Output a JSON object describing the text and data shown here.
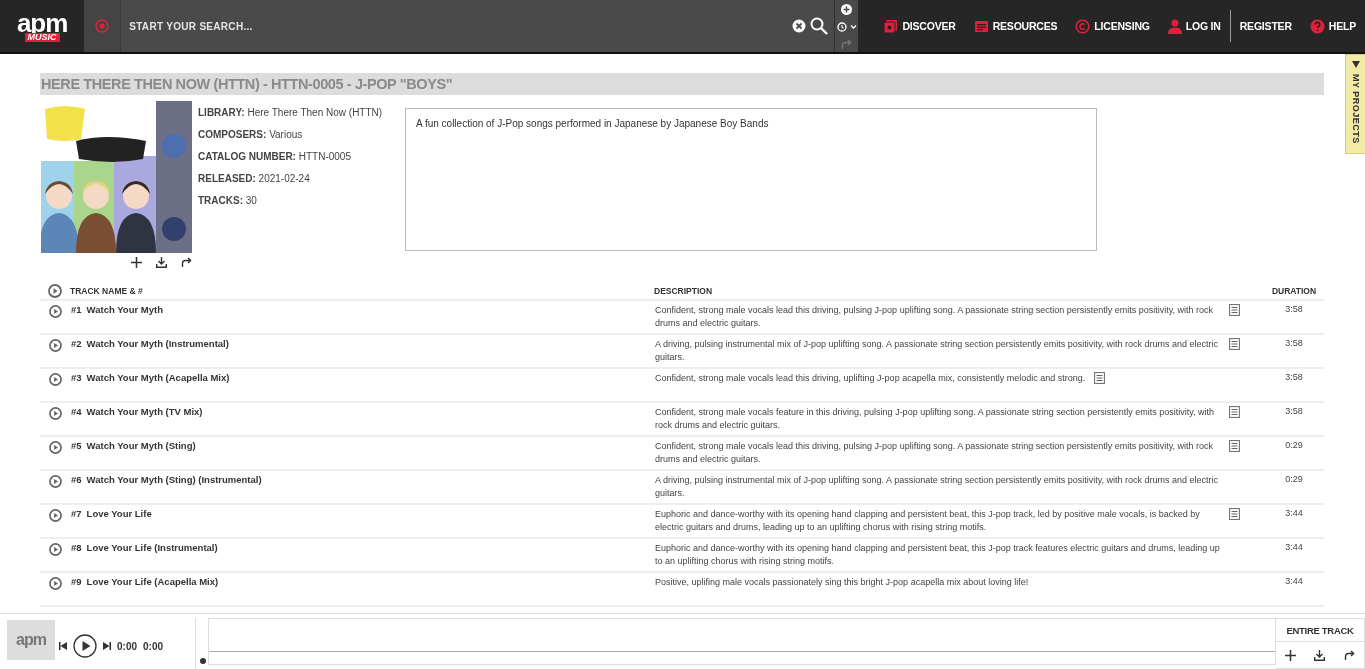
{
  "header": {
    "logo": "apm",
    "logo_sub": "MUSIC",
    "search": {
      "placeholder": "START YOUR SEARCH..."
    },
    "nav": [
      {
        "label": "DISCOVER",
        "kind": "discover"
      },
      {
        "label": "RESOURCES",
        "kind": "resources"
      },
      {
        "label": "LICENSING",
        "kind": "licensing"
      },
      {
        "label": "LOG IN",
        "kind": "login"
      },
      {
        "label": "REGISTER",
        "kind": "plain"
      },
      {
        "label": "HELP",
        "kind": "help"
      }
    ]
  },
  "side_tab": {
    "label": "MY PROJECTS"
  },
  "album": {
    "title": "HERE THERE THEN NOW (HTTN) - HTTN-0005 - J-POP \"BOYS\"",
    "details": [
      {
        "label": "LIBRARY:",
        "value": "Here There Then Now (HTTN)"
      },
      {
        "label": "COMPOSERS:",
        "value": "Various"
      },
      {
        "label": "CATALOG NUMBER:",
        "value": "HTTN-0005"
      },
      {
        "label": "RELEASED:",
        "value": "2021-02-24"
      },
      {
        "label": "TRACKS:",
        "value": "30"
      }
    ],
    "description": "A fun collection of J-Pop songs performed in Japanese by Japanese Boy Bands"
  },
  "table": {
    "columns": [
      "TRACK NAME & #",
      "DESCRIPTION",
      "DURATION"
    ],
    "rows": [
      {
        "number": "#1",
        "name": "Watch Your Myth",
        "description": "Confident, strong male vocals lead this driving, pulsing J-pop uplifting song. A passionate string section persistently emits positivity, with rock drums and electric guitars.",
        "has_notes": true,
        "duration": "3:58"
      },
      {
        "number": "#2",
        "name": "Watch Your Myth (Instrumental)",
        "description": "A driving, pulsing instrumental mix of J-pop uplifting song. A passionate string section persistently emits positivity, with rock drums and electric guitars.",
        "has_notes": true,
        "duration": "3:58"
      },
      {
        "number": "#3",
        "name": "Watch Your Myth (Acapella Mix)",
        "description": "Confident, strong male vocals lead this driving, uplifting J-pop acapella mix, consistently melodic and strong.",
        "has_notes": true,
        "duration": "3:58"
      },
      {
        "number": "#4",
        "name": "Watch Your Myth (TV Mix)",
        "description": "Confident, strong male vocals feature in this driving, pulsing J-pop uplifting song. A passionate string section persistently emits positivity, with rock drums and electric guitars.",
        "has_notes": true,
        "duration": "3:58"
      },
      {
        "number": "#5",
        "name": "Watch Your Myth (Sting)",
        "description": "Confident, strong male vocals lead this driving, pulsing J-pop uplifting song. A passionate string section persistently emits positivity, with rock drums and electric guitars.",
        "has_notes": true,
        "duration": "0:29"
      },
      {
        "number": "#6",
        "name": "Watch Your Myth (Sting) (Instrumental)",
        "description": "A driving, pulsing instrumental mix of J-pop uplifting song. A passionate string section persistently emits positivity, with rock drums and electric guitars.",
        "has_notes": false,
        "duration": "0:29"
      },
      {
        "number": "#7",
        "name": "Love Your Life",
        "description": "Euphoric and dance-worthy with its opening hand clapping and persistent beat, this J-pop track, led by positive male vocals, is backed by electric guitars and drums, leading up to an uplifting chorus with rising string motifs.",
        "has_notes": true,
        "duration": "3:44"
      },
      {
        "number": "#8",
        "name": "Love Your Life (Instrumental)",
        "description": "Euphoric and dance-worthy with its opening hand clapping and persistent beat, this J-pop track features electric guitars and drums, leading up to an uplifting chorus with rising string motifs.",
        "has_notes": false,
        "duration": "3:44"
      },
      {
        "number": "#9",
        "name": "Love Your Life (Acapella Mix)",
        "description": "Positive, uplifing male vocals passionately sing this bright J-pop acapella mix about loving life!",
        "has_notes": false,
        "duration": "3:44"
      }
    ]
  },
  "player": {
    "logo": "apm",
    "elapsed": "0:00",
    "total": "0:00",
    "mode": "ENTIRE TRACK"
  }
}
